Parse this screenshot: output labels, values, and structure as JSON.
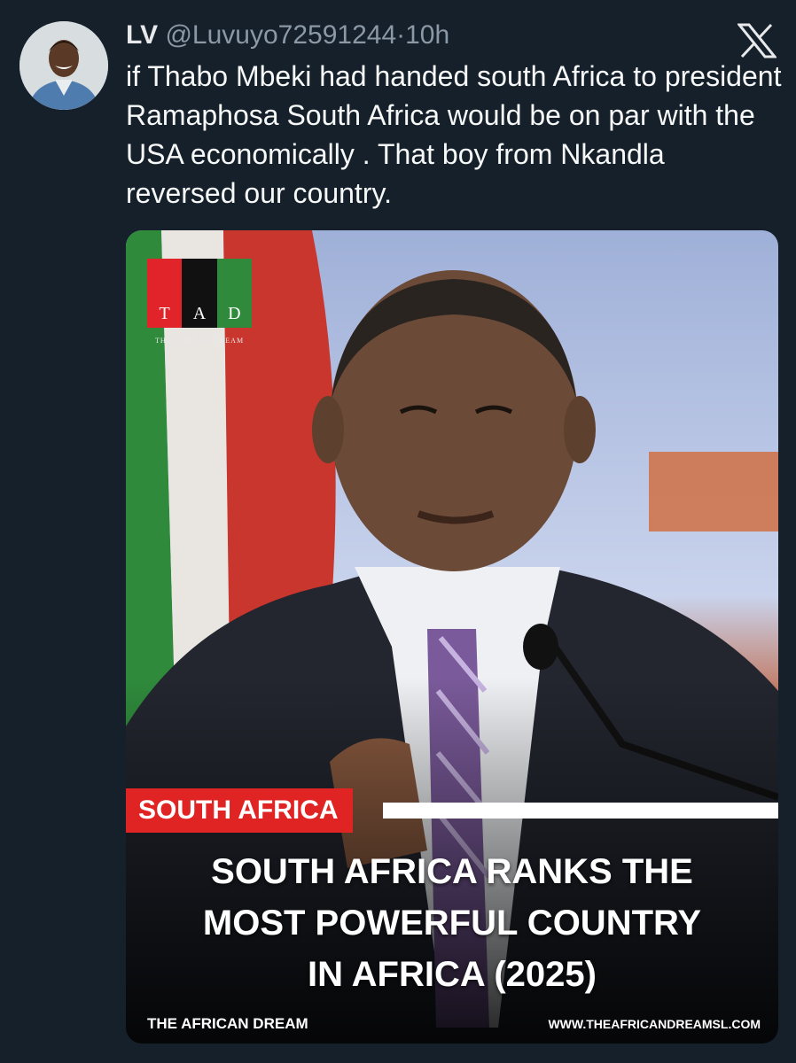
{
  "tweet": {
    "display_name": "LV",
    "handle": "@Luvuyo72591244",
    "separator": "·",
    "time": "10h",
    "text": "if Thabo Mbeki had handed south Africa to president Ramaphosa South Africa would be on par with the USA economically . That boy from Nkandla reversed our country."
  },
  "media": {
    "logo_letters": [
      "T",
      "A",
      "D"
    ],
    "logo_tagline": "THE AFRICAN DREAM",
    "category": "SOUTH AFRICA",
    "headline_lines": [
      "SOUTH AFRICA RANKS THE",
      "MOST POWERFUL COUNTRY",
      "IN AFRICA (2025)"
    ],
    "footer_left": "THE AFRICAN DREAM",
    "footer_right": "WWW.THEAFRICANDREAMSL.COM"
  },
  "icons": {
    "platform": "x-logo-icon",
    "avatar": "avatar"
  },
  "colors": {
    "background": "#15202b",
    "category_red": "#e02424",
    "logo_red": "#e0242a",
    "logo_black": "#111111",
    "logo_green": "#2f8a3c"
  }
}
